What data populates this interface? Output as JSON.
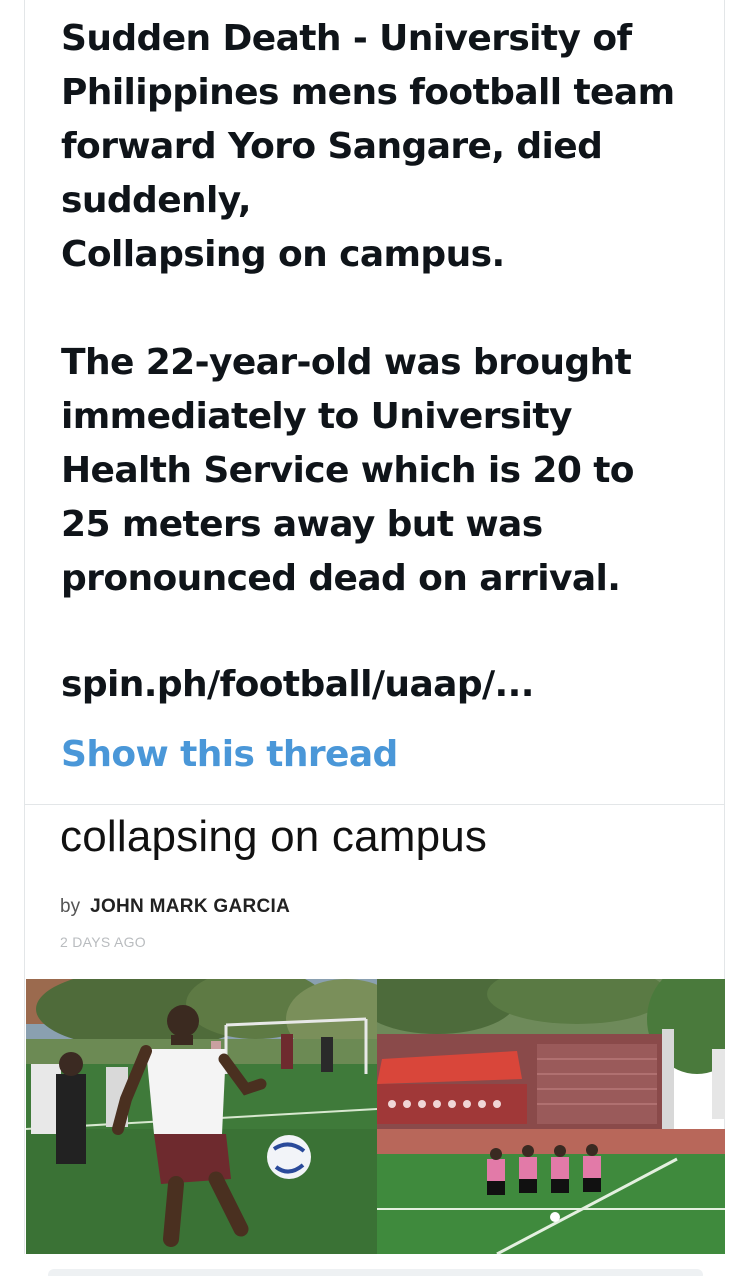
{
  "tweet": {
    "line1": "Sudden Death - University of",
    "line2": "Philippines mens football team",
    "line3": "forward Yoro Sangare, died",
    "line4": "suddenly,",
    "line5": "Collapsing on campus.",
    "line6": "The 22-year-old was brought",
    "line7": "immediately to University",
    "line8": "Health Service which is 20 to",
    "line9": "25 meters away but was",
    "line10": "pronounced dead on arrival.",
    "link": "spin.ph/football/uaap/...",
    "show_thread": "Show this thread"
  },
  "article": {
    "title": "collapsing on campus",
    "by_label": "by",
    "author": "JOHN MARK GARCIA",
    "time_ago": "2 DAYS AGO"
  },
  "colors": {
    "link_blue": "#4a97d8",
    "text": "#0f1419",
    "pitch_green": "#3f7a3a",
    "team_maroon": "#6e2a2e",
    "referee_pink": "#e27aa8"
  }
}
